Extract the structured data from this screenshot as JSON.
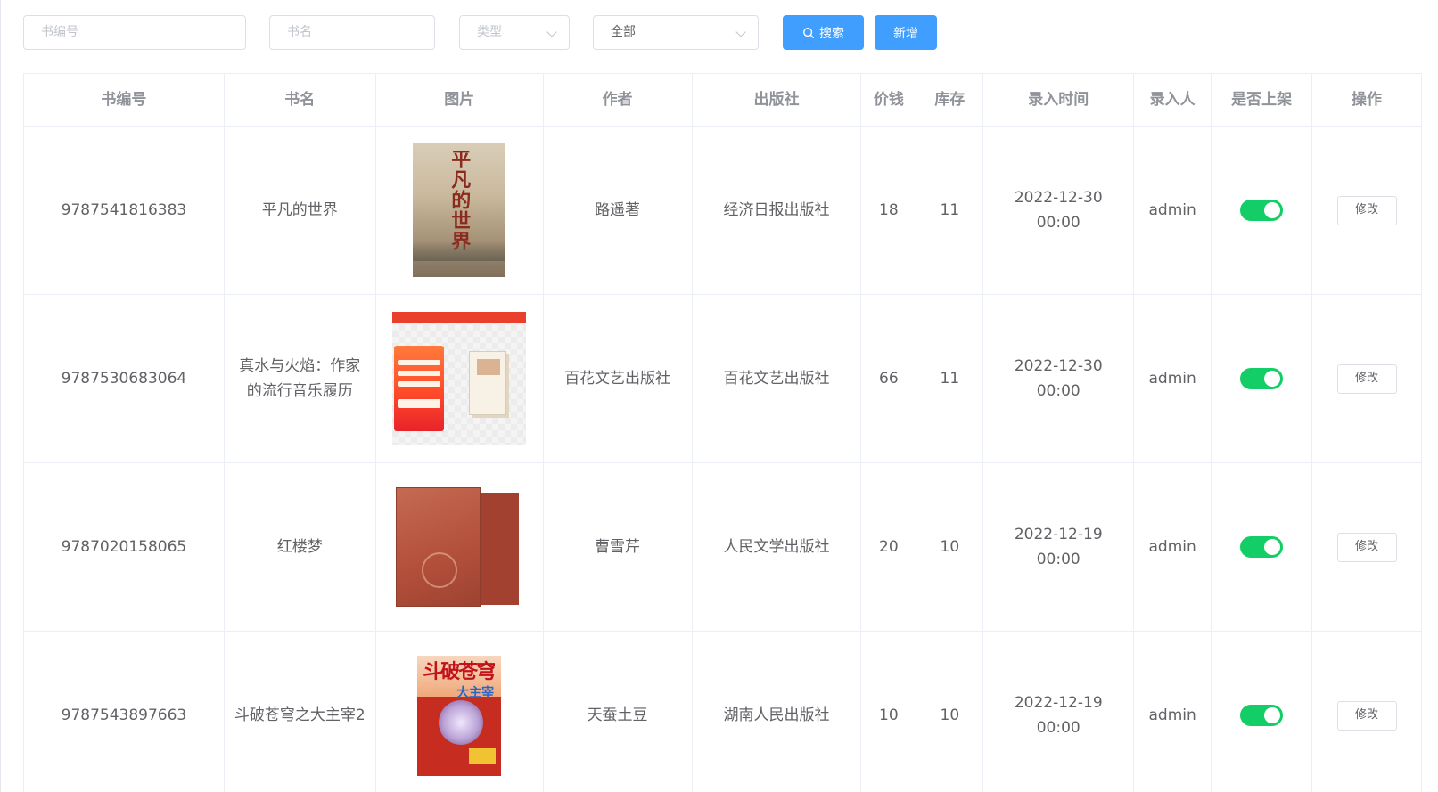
{
  "toolbar": {
    "book_id_placeholder": "书编号",
    "book_name_placeholder": "书名",
    "type_placeholder": "类型",
    "status_value": "全部",
    "search_label": "搜索",
    "add_label": "新增",
    "accent_color": "#409eff"
  },
  "table": {
    "headers": [
      "书编号",
      "书名",
      "图片",
      "作者",
      "出版社",
      "价钱",
      "库存",
      "录入时间",
      "录入人",
      "是否上架",
      "操作"
    ],
    "rows": [
      {
        "book_id": "9787541816383",
        "name": "平凡的世界",
        "cover_icon": "book-cover-image",
        "cover_title": "平凡的世界",
        "author": "路遥著",
        "publisher": "经济日报出版社",
        "price": "18",
        "stock": "11",
        "created": "2022-12-30 00:00",
        "creator": "admin",
        "on_shelf": true,
        "action": "修改"
      },
      {
        "book_id": "9787530683064",
        "name": "真水与火焰：作家的流行音乐履历",
        "cover_icon": "book-cover-image",
        "author": "百花文艺出版社",
        "publisher": "百花文艺出版社",
        "price": "66",
        "stock": "11",
        "created": "2022-12-30 00:00",
        "creator": "admin",
        "on_shelf": true,
        "action": "修改"
      },
      {
        "book_id": "9787020158065",
        "name": "红楼梦",
        "cover_icon": "book-cover-image",
        "author": "曹雪芹",
        "publisher": "人民文学出版社",
        "price": "20",
        "stock": "10",
        "created": "2022-12-19 00:00",
        "creator": "admin",
        "on_shelf": true,
        "action": "修改"
      },
      {
        "book_id": "9787543897663",
        "name": "斗破苍穹之大主宰2",
        "cover_icon": "book-cover-image",
        "cover_title": "斗破苍穹",
        "cover_subtitle": "大主宰",
        "author": "天蚕土豆",
        "publisher": "湖南人民出版社",
        "price": "10",
        "stock": "10",
        "created": "2022-12-19 00:00",
        "creator": "admin",
        "on_shelf": true,
        "action": "修改"
      }
    ],
    "toggle_on_color": "#13ce66"
  }
}
